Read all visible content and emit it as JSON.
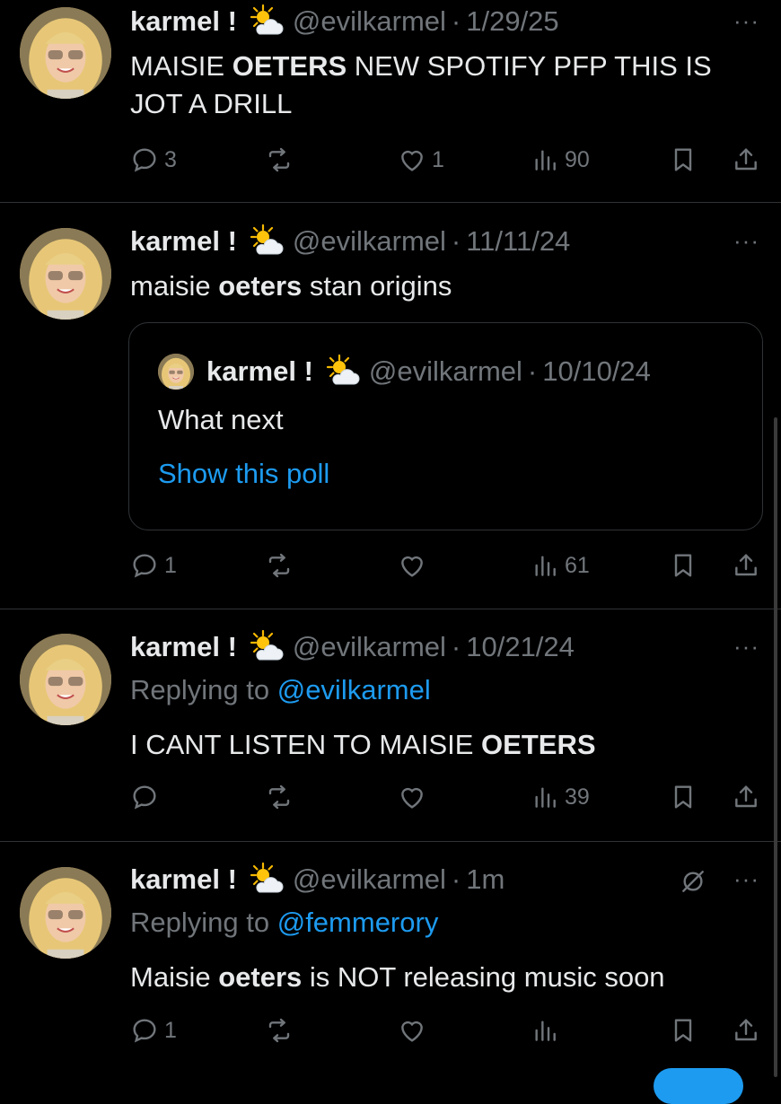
{
  "tweets": [
    {
      "name": "karmel !",
      "handle": "@evilkarmel",
      "sep": "·",
      "date": "1/29/25",
      "more": "···",
      "text_parts": [
        "MAISIE ",
        "OETERS",
        " NEW SPOTIFY PFP THIS IS JOT A DRILL"
      ],
      "replies": "3",
      "likes": "1",
      "views": "90"
    },
    {
      "name": "karmel !",
      "handle": "@evilkarmel",
      "sep": "·",
      "date": "11/11/24",
      "more": "···",
      "text_parts": [
        "maisie ",
        "oeters",
        " stan origins"
      ],
      "quote": {
        "name": "karmel !",
        "handle": "@evilkarmel",
        "sep": "·",
        "date": "10/10/24",
        "text": "What next",
        "link": "Show this poll"
      },
      "replies": "1",
      "likes": "",
      "views": "61"
    },
    {
      "name": "karmel !",
      "handle": "@evilkarmel",
      "sep": "·",
      "date": "10/21/24",
      "more": "···",
      "reply_prefix": "Replying to ",
      "reply_to": "@evilkarmel",
      "text_parts": [
        "I CANT LISTEN TO MAISIE ",
        "OETERS",
        ""
      ],
      "replies": "",
      "likes": "",
      "views": "39"
    },
    {
      "name": "karmel !",
      "handle": "@evilkarmel",
      "sep": "·",
      "date": "1m",
      "more": "···",
      "reply_prefix": "Replying to ",
      "reply_to": "@femmerory",
      "text_parts": [
        "Maisie ",
        "oeters",
        " is NOT releasing music soon"
      ],
      "replies": "1",
      "likes": "",
      "views": ""
    }
  ],
  "colors": {
    "background": "#000000",
    "text": "#e7e9ea",
    "muted": "#71767b",
    "accent": "#1d9bf0",
    "divider": "#2f3336"
  },
  "icons": {
    "reply": "reply-icon",
    "retweet": "retweet-icon",
    "like": "heart-icon",
    "views": "views-icon",
    "bookmark": "bookmark-icon",
    "share": "share-icon",
    "more": "more-icon",
    "emoji": "sun-behind-cloud-emoji",
    "edit": "edit-icon"
  }
}
